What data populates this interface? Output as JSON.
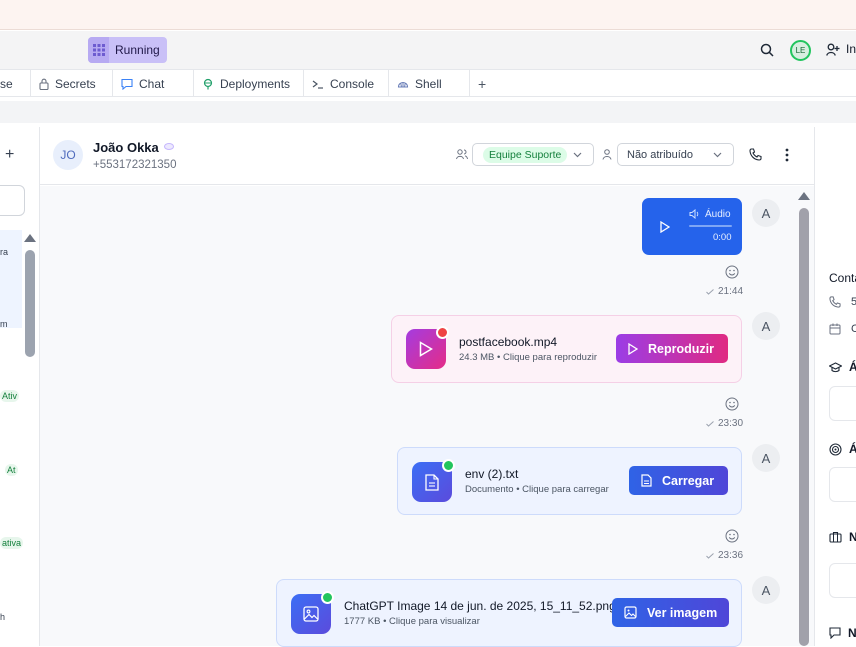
{
  "top": {
    "running_label": "Running",
    "avatar_initials": "LE",
    "invite_label": "In"
  },
  "tabs": [
    {
      "label": "se"
    },
    {
      "label": "Secrets"
    },
    {
      "label": "Chat"
    },
    {
      "label": "Deployments"
    },
    {
      "label": "Console"
    },
    {
      "label": "Shell"
    },
    {
      "label": "+"
    }
  ],
  "left_list": {
    "add": "+",
    "items": [
      "ra",
      "m",
      "Ativ",
      "At",
      "ativa",
      "h"
    ]
  },
  "contact": {
    "initials": "JO",
    "name": "João Okka",
    "phone": "+553172321350",
    "team": "Equipe Suporte",
    "assignee": "Não atribuído"
  },
  "messages": {
    "audio": {
      "label": "Áudio",
      "duration": "0:00",
      "time": "21:44"
    },
    "video": {
      "name": "postfacebook.mp4",
      "meta": "24.3 MB • Clique para reproduzir",
      "button": "Reproduzir",
      "time": "23:30"
    },
    "doc": {
      "name": "env (2).txt",
      "meta": "Documento • Clique para carregar",
      "button": "Carregar",
      "time": "23:36"
    },
    "image": {
      "name": "ChatGPT Image 14 de jun. de 2025, 15_11_52.png",
      "meta": "1777 KB • Clique para visualizar",
      "button": "Ver imagem"
    },
    "avatar": "A"
  },
  "right_panel": {
    "contact_label": "Conta",
    "phone_fragment": "5",
    "date_fragment": "C",
    "section1": "Á",
    "section2": "Á",
    "section3": "N",
    "section4": "N"
  }
}
